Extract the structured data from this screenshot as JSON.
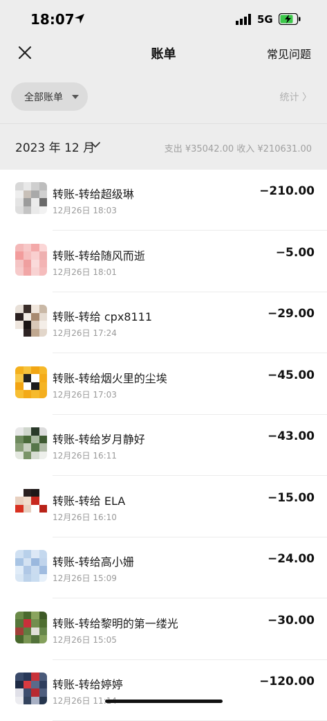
{
  "status_bar": {
    "time": "18:07",
    "network": "5G"
  },
  "nav": {
    "title": "账单",
    "faq": "常见问题"
  },
  "filter": {
    "label": "全部账单",
    "stats": "统计 〉"
  },
  "month": {
    "label": "2023 年 12 月",
    "summary": "支出 ¥35042.00 收入 ¥210631.00"
  },
  "transactions": [
    {
      "title": "转账-转给超级琳",
      "time": "12月26日 18:03",
      "amount": "−210.00",
      "avatar_colors": [
        "#d8d8d8",
        "#e8e8e8",
        "#cfcfcf",
        "#bdbdbd",
        "#eeeeee",
        "#c8c0b8",
        "#a9a9a9",
        "#d0d0d0",
        "#e4e4e4",
        "#9c9c9c",
        "#ececec",
        "#6a6a6a",
        "#dedede",
        "#c4c4c4",
        "#eaeaea",
        "#f2f2f2"
      ]
    },
    {
      "title": "转账-转给随风而逝",
      "time": "12月26日 18:01",
      "amount": "−5.00",
      "avatar_colors": [
        "#f4b8b8",
        "#f7c8c8",
        "#f3a9a9",
        "#fbd6d6",
        "#f29c9c",
        "#f6bebe",
        "#f9cfcf",
        "#eeb0b0",
        "#f4c4c4",
        "#ef9f9f",
        "#fadada",
        "#f3b4b4",
        "#f6caca",
        "#f1a6a6",
        "#f8d2d2",
        "#f5bcbc"
      ]
    },
    {
      "title": "转账-转给 cpx8111",
      "time": "12月26日 17:24",
      "amount": "−29.00",
      "avatar_colors": [
        "#e8e0d8",
        "#3a2e2a",
        "#f0e6dc",
        "#c9b8a6",
        "#2a2020",
        "#f2ebe4",
        "#a88a70",
        "#e6dcd2",
        "#eee6de",
        "#1a1414",
        "#d8c8b8",
        "#f4eee8",
        "#ffffff",
        "#2e2424",
        "#c0a890",
        "#e2d6ca"
      ]
    },
    {
      "title": "转账-转给烟火里的尘埃",
      "time": "12月26日 17:03",
      "amount": "−45.00",
      "avatar_colors": [
        "#f4b01c",
        "#f7c23a",
        "#f2a614",
        "#f6b828",
        "#f8c848",
        "#222222",
        "#ffffff",
        "#f4ac1a",
        "#f2a412",
        "#ffffff",
        "#1c1c1c",
        "#f5b424",
        "#f7be32",
        "#f3aa18",
        "#f6ba2c",
        "#f4ae1e"
      ]
    },
    {
      "title": "转账-转给岁月静好",
      "time": "12月26日 16:11",
      "amount": "−43.00",
      "avatar_colors": [
        "#e8e8e8",
        "#cfd6cc",
        "#2a3a2a",
        "#dcdcdc",
        "#6e8a5e",
        "#4a6a3a",
        "#a8b8a0",
        "#3e5a32",
        "#8aa07a",
        "#c8d0c0",
        "#56764a",
        "#b0bca8",
        "#e4e8e0",
        "#7a9468",
        "#d6dcd2",
        "#eef0ec"
      ]
    },
    {
      "title": "转账-转给 ELA",
      "time": "12月26日 16:10",
      "amount": "−15.00",
      "avatar_colors": [
        "#ffffff",
        "#2a2020",
        "#1e1818",
        "#ffffff",
        "#e8d0c0",
        "#f0dccc",
        "#c8281e",
        "#ffffff",
        "#d83020",
        "#e8cfc0",
        "#ffffff",
        "#b82218",
        "#ffffff",
        "#ffffff",
        "#ffffff",
        "#ffffff"
      ]
    },
    {
      "title": "转账-转给高小姗",
      "time": "12月26日 15:09",
      "amount": "−24.00",
      "avatar_colors": [
        "#cfe0f2",
        "#b8d0ea",
        "#dce8f6",
        "#c4d8ee",
        "#a8c4e4",
        "#d4e2f2",
        "#9ab8de",
        "#c0d4ec",
        "#e0ecf8",
        "#b0c8e6",
        "#cadcf0",
        "#a0bce0",
        "#d8e6f4",
        "#bcd2ea",
        "#c8dcf0",
        "#e6f0fa"
      ]
    },
    {
      "title": "转账-转给黎明的第一缕光",
      "time": "12月26日 15:05",
      "amount": "−30.00",
      "avatar_colors": [
        "#6a8a48",
        "#4a6a2e",
        "#8aa45e",
        "#3e5a26",
        "#56763a",
        "#c8303a",
        "#728e4e",
        "#4e6e30",
        "#a04038",
        "#5e7e40",
        "#e0e0d8",
        "#66864a",
        "#48682c",
        "#7a9654",
        "#52723a",
        "#84a05c"
      ]
    },
    {
      "title": "转账-转给婷婷",
      "time": "12月26日 11:14",
      "amount": "−120.00",
      "avatar_colors": [
        "#3a4a6a",
        "#283858",
        "#c8323a",
        "#4a5a7a",
        "#1e2a44",
        "#d83a40",
        "#5a6a8a",
        "#2e3e5e",
        "#e0e0e8",
        "#3e4e6e",
        "#b82a32",
        "#4e5e7e",
        "#ececf0",
        "#34445e",
        "#a8b0c4",
        "#26364e"
      ]
    }
  ]
}
